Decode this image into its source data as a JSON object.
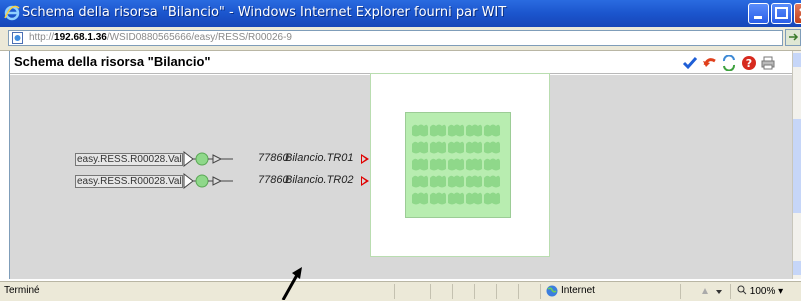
{
  "window": {
    "title": "Schema della risorsa \"Bilancio\" - Windows Internet Explorer fourni par WIT"
  },
  "address": {
    "url_prefix": "http://",
    "url_host": "192.68.1.36",
    "url_path": "/WSID0880565666/easy/RESS/R00026-9"
  },
  "page": {
    "title": "Schema della risorsa \"Bilancio\""
  },
  "toolbar_icons": [
    "checkmark-icon",
    "undo-icon",
    "refresh-icon",
    "help-icon",
    "print-icon"
  ],
  "rows": [
    {
      "field": "easy.RESS.R00028.Valu",
      "value": "77860",
      "tag": "Bilancio.TR01"
    },
    {
      "field": "easy.RESS.R00028.Valu",
      "value": "77860",
      "tag": "Bilancio.TR02"
    }
  ],
  "status": {
    "text": "Terminé",
    "zone": "Internet",
    "zoom": "100%"
  },
  "colors": {
    "titlebar": "#1b55cd",
    "panel_fill": "#b8edb0",
    "cells": "#8fd88a",
    "alarm": "#e00000"
  }
}
